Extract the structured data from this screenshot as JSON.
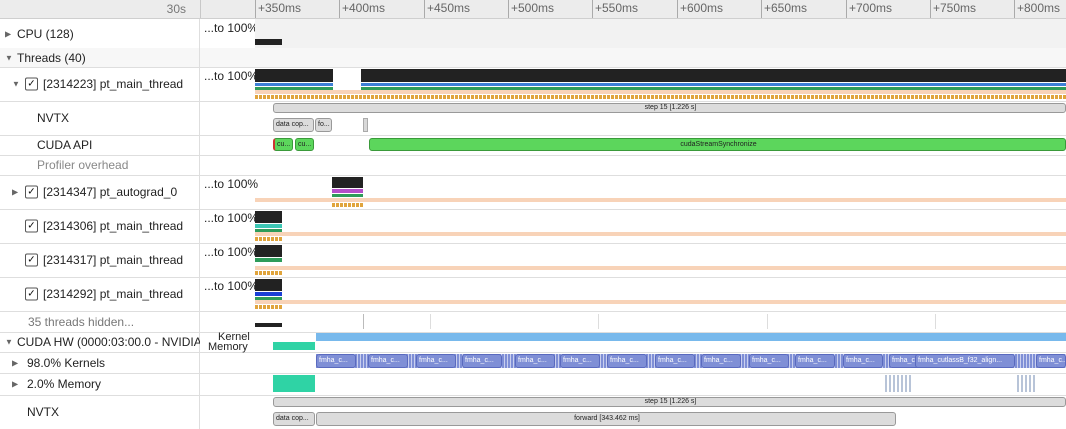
{
  "timeline": {
    "start_label": "30s",
    "ticks": [
      "+350ms",
      "+400ms",
      "+450ms",
      "+500ms",
      "+550ms",
      "+600ms",
      "+650ms",
      "+700ms",
      "+750ms",
      "+800ms"
    ]
  },
  "rows": {
    "cpu": {
      "label": "CPU (128)",
      "pct": "...to 100%"
    },
    "threads": {
      "label": "Threads (40)"
    },
    "main_thread": {
      "label": "[2314223] pt_main_thread",
      "pct": "...to 100%"
    },
    "nvtx_top": {
      "label": "NVTX",
      "slices": [
        "data cop...",
        "fo...",
        "step 15 [1.226 s]"
      ]
    },
    "cuda_api": {
      "label": "CUDA API",
      "slices": [
        "cu...",
        "cu...",
        "cudaStreamSynchronize"
      ]
    },
    "profiler_overhead": {
      "label": "Profiler overhead"
    },
    "autograd": {
      "label": "[2314347] pt_autograd_0",
      "pct": "...to 100%"
    },
    "t306": {
      "label": "[2314306] pt_main_thread",
      "pct": "...to 100%"
    },
    "t317": {
      "label": "[2314317] pt_main_thread",
      "pct": "...to 100%"
    },
    "t292": {
      "label": "[2314292] pt_main_thread",
      "pct": "...to 100%"
    },
    "hidden": {
      "label": "35 threads hidden..."
    },
    "cuda_hw": {
      "label": "CUDA HW (0000:03:00.0 - NVIDIA",
      "legend_kernel": "Kernel",
      "legend_memory": "Memory"
    },
    "kernels": {
      "label": "98.0% Kernels",
      "slice_label": "fmha_c...",
      "long_slice": "fmha_cutlassB_f32_align..."
    },
    "memory": {
      "label": "2.0% Memory"
    },
    "nvtx_bottom": {
      "label": "NVTX",
      "slices": [
        "step 15 [1.226 s]",
        "data cop...",
        "forward [343.462 ms]"
      ]
    }
  },
  "colors": {
    "kernel": "#7f8fd6",
    "memory": "#2fd3a5",
    "cuda_api": "#5cd65c",
    "timeline_bar": "#78b9ec",
    "busy": "#222222"
  }
}
